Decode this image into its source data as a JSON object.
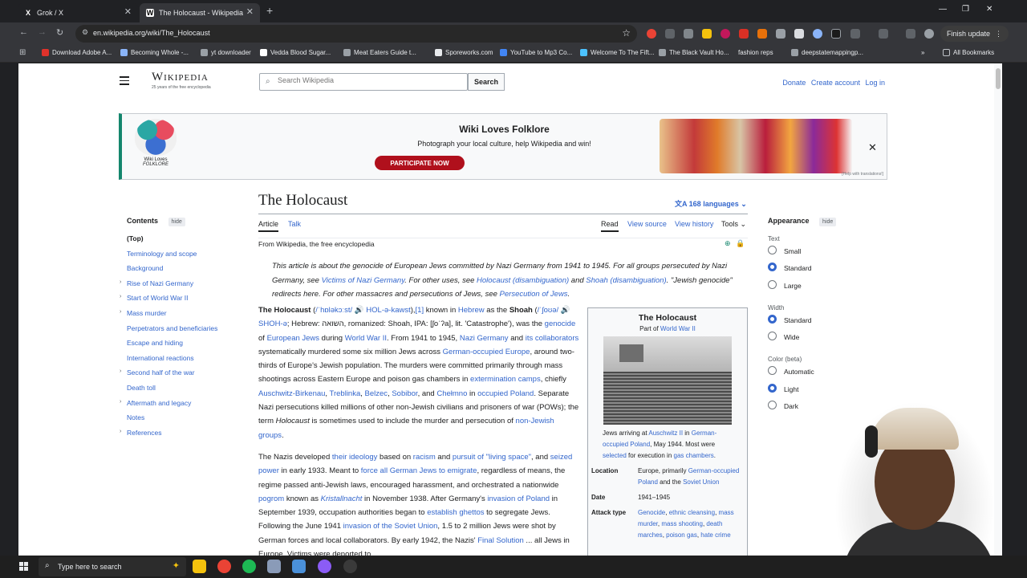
{
  "browser": {
    "tabs": [
      {
        "favicon": "X",
        "title": "Grok / X"
      },
      {
        "favicon": "W",
        "title": "The Holocaust - Wikipedia"
      }
    ],
    "new_tab": "+",
    "window_controls": [
      "—",
      "❐",
      "✕"
    ],
    "url": "en.wikipedia.org/wiki/The_Holocaust",
    "finish_update": "Finish update",
    "bookmarks": [
      {
        "label": "Download Adobe A...",
        "color": "#e0322b"
      },
      {
        "label": "Becoming Whole -...",
        "color": "#8ab4f8"
      },
      {
        "label": "yt downloader",
        "color": "#9aa0a6"
      },
      {
        "label": "Vedda Blood Sugar...",
        "color": "#ffffff"
      },
      {
        "label": "Meat Eaters Guide t...",
        "color": "#9aa0a6"
      },
      {
        "label": "Sporeworks.com",
        "color": "#e8eaed"
      },
      {
        "label": "YouTube to Mp3 Co...",
        "color": "#4285f4"
      },
      {
        "label": "Welcome To The Fift...",
        "color": "#4cc2ff"
      },
      {
        "label": "The Black Vault Ho...",
        "color": "#9aa0a6"
      },
      {
        "label": "fashion reps",
        "color": ""
      },
      {
        "label": "deepstatemappingp...",
        "color": "#9aa0a6"
      }
    ],
    "all_bookmarks": "All Bookmarks"
  },
  "wiki": {
    "logo_wordmark": "Wikipedia",
    "logo_tagline": "25 years of the free encyclopedia",
    "search_placeholder": "Search Wikipedia",
    "search_button": "Search",
    "top_links": [
      "Donate",
      "Create account",
      "Log in"
    ],
    "banner": {
      "logo_line1": "Wiki Loves",
      "logo_line2": "FOLKLORE",
      "title": "Wiki Loves Folklore",
      "subtitle": "Photograph your local culture, help Wikipedia and win!",
      "button": "PARTICIPATE NOW",
      "help": "[Help with translations!]"
    },
    "toc": {
      "heading": "Contents",
      "hide": "hide",
      "items": [
        {
          "label": "(Top)",
          "toggle": false
        },
        {
          "label": "Terminology and scope",
          "toggle": false
        },
        {
          "label": "Background",
          "toggle": false
        },
        {
          "label": "Rise of Nazi Germany",
          "toggle": true
        },
        {
          "label": "Start of World War II",
          "toggle": true
        },
        {
          "label": "Mass murder",
          "toggle": true
        },
        {
          "label": "Perpetrators and beneficiaries",
          "toggle": false
        },
        {
          "label": "Escape and hiding",
          "toggle": false
        },
        {
          "label": "International reactions",
          "toggle": false
        },
        {
          "label": "Second half of the war",
          "toggle": true
        },
        {
          "label": "Death toll",
          "toggle": false
        },
        {
          "label": "Aftermath and legacy",
          "toggle": true
        },
        {
          "label": "Notes",
          "toggle": false
        },
        {
          "label": "References",
          "toggle": true
        }
      ]
    },
    "title": "The Holocaust",
    "languages": "168 languages",
    "tabs_left": [
      "Article",
      "Talk"
    ],
    "tabs_right": [
      "Read",
      "View source",
      "View history",
      "Tools"
    ],
    "from_wiki": "From Wikipedia, the free encyclopedia",
    "hatnote": [
      {
        "t": "This article is about the genocide of European Jews committed by Nazi Germany from 1941 to 1945. For all groups persecuted by Nazi Germany, see ",
        "link": false
      },
      {
        "t": "Victims of Nazi Germany",
        "link": true
      },
      {
        "t": ". For other uses, see ",
        "link": false
      },
      {
        "t": "Holocaust (disambiguation)",
        "link": true
      },
      {
        "t": " and ",
        "link": false
      },
      {
        "t": "Shoah (disambiguation)",
        "link": true
      },
      {
        "t": ". \"Jewish genocide\" redirects here. For other massacres and persecutions of Jews, see ",
        "link": false
      },
      {
        "t": "Persecution of Jews",
        "link": true
      },
      {
        "t": ".",
        "link": false
      }
    ],
    "paragraph1": [
      {
        "t": "The Holocaust",
        "link": false,
        "b": true
      },
      {
        "t": " (",
        "link": false
      },
      {
        "t": "/ˈhɒləkɔːst/ 🔊 HOL-ə-kawst",
        "link": true
      },
      {
        "t": "),",
        "link": false
      },
      {
        "t": "[1]",
        "link": true
      },
      {
        "t": " known in ",
        "link": false
      },
      {
        "t": "Hebrew",
        "link": true
      },
      {
        "t": " as the ",
        "link": false
      },
      {
        "t": "Shoah",
        "link": false,
        "b": true
      },
      {
        "t": " (",
        "link": false
      },
      {
        "t": "/ˈʃoʊə/ 🔊 SHOH-ə",
        "link": true
      },
      {
        "t": "; Hebrew: השואה, romanized: Shoah, IPA: [ʃoˈʔa], lit. 'Catastrophe'), was the ",
        "link": false
      },
      {
        "t": "genocide",
        "link": true
      },
      {
        "t": " of ",
        "link": false
      },
      {
        "t": "European Jews",
        "link": true
      },
      {
        "t": " during ",
        "link": false
      },
      {
        "t": "World War II",
        "link": true
      },
      {
        "t": ". From 1941 to 1945, ",
        "link": false
      },
      {
        "t": "Nazi Germany",
        "link": true
      },
      {
        "t": " and ",
        "link": false
      },
      {
        "t": "its collaborators",
        "link": true
      },
      {
        "t": " systematically murdered some six million Jews across ",
        "link": false
      },
      {
        "t": "German-occupied Europe",
        "link": true
      },
      {
        "t": ", around two-thirds of Europe's Jewish population. The murders were committed primarily through mass shootings across Eastern Europe and poison gas chambers in ",
        "link": false
      },
      {
        "t": "extermination camps",
        "link": true
      },
      {
        "t": ", chiefly ",
        "link": false
      },
      {
        "t": "Auschwitz-Birkenau",
        "link": true
      },
      {
        "t": ", ",
        "link": false
      },
      {
        "t": "Treblinka",
        "link": true
      },
      {
        "t": ", ",
        "link": false
      },
      {
        "t": "Belzec",
        "link": true
      },
      {
        "t": ", ",
        "link": false
      },
      {
        "t": "Sobibor",
        "link": true
      },
      {
        "t": ", and ",
        "link": false
      },
      {
        "t": "Chełmno",
        "link": true
      },
      {
        "t": " in ",
        "link": false
      },
      {
        "t": "occupied Poland",
        "link": true
      },
      {
        "t": ". Separate Nazi persecutions killed millions of other non-Jewish civilians and prisoners of war (POWs); the term ",
        "link": false
      },
      {
        "t": "Holocaust",
        "link": false,
        "i": true
      },
      {
        "t": " is sometimes used to include the murder and persecution of ",
        "link": false
      },
      {
        "t": "non-Jewish groups",
        "link": true
      },
      {
        "t": ".",
        "link": false
      }
    ],
    "paragraph2": [
      {
        "t": "The Nazis developed ",
        "link": false
      },
      {
        "t": "their ideology",
        "link": true
      },
      {
        "t": " based on ",
        "link": false
      },
      {
        "t": "racism",
        "link": true
      },
      {
        "t": " and ",
        "link": false
      },
      {
        "t": "pursuit of \"living space\"",
        "link": true
      },
      {
        "t": ", and ",
        "link": false
      },
      {
        "t": "seized power",
        "link": true
      },
      {
        "t": " in early 1933. Meant to ",
        "link": false
      },
      {
        "t": "force all German Jews to emigrate",
        "link": true
      },
      {
        "t": ", regardless of means, the regime passed anti-Jewish laws, encouraged harassment, and orchestrated a nationwide ",
        "link": false
      },
      {
        "t": "pogrom",
        "link": true
      },
      {
        "t": " known as ",
        "link": false
      },
      {
        "t": "Kristallnacht",
        "link": true,
        "i": true
      },
      {
        "t": " in November 1938. After Germany's ",
        "link": false
      },
      {
        "t": "invasion of Poland",
        "link": true
      },
      {
        "t": " in September 1939, occupation authorities began to ",
        "link": false
      },
      {
        "t": "establish ghettos",
        "link": true
      },
      {
        "t": " to segregate Jews. Following the June 1941 ",
        "link": false
      },
      {
        "t": "invasion of the Soviet Union",
        "link": true
      },
      {
        "t": ", 1.5 to 2 million Jews were shot by German forces and local collaborators. By early 1942, the Nazis' ",
        "link": false
      },
      {
        "t": "Final Solution",
        "link": true
      },
      {
        "t": " ... all Jews in Europe. Victims were deported to",
        "link": false
      }
    ],
    "infobox": {
      "title": "The Holocaust",
      "part_of_prefix": "Part of ",
      "part_of_link": "World War II",
      "caption": [
        {
          "t": "Jews arriving at ",
          "link": false
        },
        {
          "t": "Auschwitz II",
          "link": true
        },
        {
          "t": " in ",
          "link": false
        },
        {
          "t": "German-occupied Poland",
          "link": true
        },
        {
          "t": ", May 1944. Most were ",
          "link": false
        },
        {
          "t": "selected",
          "link": true
        },
        {
          "t": " for execution in ",
          "link": false
        },
        {
          "t": "gas chambers",
          "link": true
        },
        {
          "t": ".",
          "link": false
        }
      ],
      "rows": [
        {
          "k": "Location",
          "v": [
            {
              "t": "Europe, primarily ",
              "link": false
            },
            {
              "t": "German-occupied Poland",
              "link": true
            },
            {
              "t": " and the ",
              "link": false
            },
            {
              "t": "Soviet Union",
              "link": true
            }
          ]
        },
        {
          "k": "Date",
          "v": [
            {
              "t": "1941–1945",
              "link": false
            }
          ]
        },
        {
          "k": "Attack type",
          "v": [
            {
              "t": "Genocide",
              "link": true
            },
            {
              "t": ", ",
              "link": false
            },
            {
              "t": "ethnic cleansing",
              "link": true
            },
            {
              "t": ", ",
              "link": false
            },
            {
              "t": "mass murder",
              "link": true
            },
            {
              "t": ", ",
              "link": false
            },
            {
              "t": "mass shooting",
              "link": true
            },
            {
              "t": ", ",
              "link": false
            },
            {
              "t": "death marches",
              "link": true
            },
            {
              "t": ", ",
              "link": false
            },
            {
              "t": "poison gas",
              "link": true
            },
            {
              "t": ", ",
              "link": false
            },
            {
              "t": "hate crime",
              "link": true
            }
          ]
        }
      ]
    },
    "appearance": {
      "heading": "Appearance",
      "hide": "hide",
      "groups": [
        {
          "label": "Text",
          "options": [
            "Small",
            "Standard",
            "Large"
          ],
          "selected": 1
        },
        {
          "label": "Width",
          "options": [
            "Standard",
            "Wide"
          ],
          "selected": 0
        },
        {
          "label": "Color (beta)",
          "options": [
            "Automatic",
            "Light",
            "Dark"
          ],
          "selected": 1
        }
      ]
    }
  },
  "taskbar": {
    "search_placeholder": "Type here to search",
    "apps": [
      {
        "name": "file-explorer",
        "color": "#f4c20d"
      },
      {
        "name": "chrome",
        "color": "#ea4335"
      },
      {
        "name": "spotify",
        "color": "#1db954"
      },
      {
        "name": "app-gray",
        "color": "#8a9bb8"
      },
      {
        "name": "app-blue",
        "color": "#4a90d9"
      },
      {
        "name": "app-purple",
        "color": "#8b5cf6"
      },
      {
        "name": "obs",
        "color": "#3a3a3a"
      }
    ]
  }
}
